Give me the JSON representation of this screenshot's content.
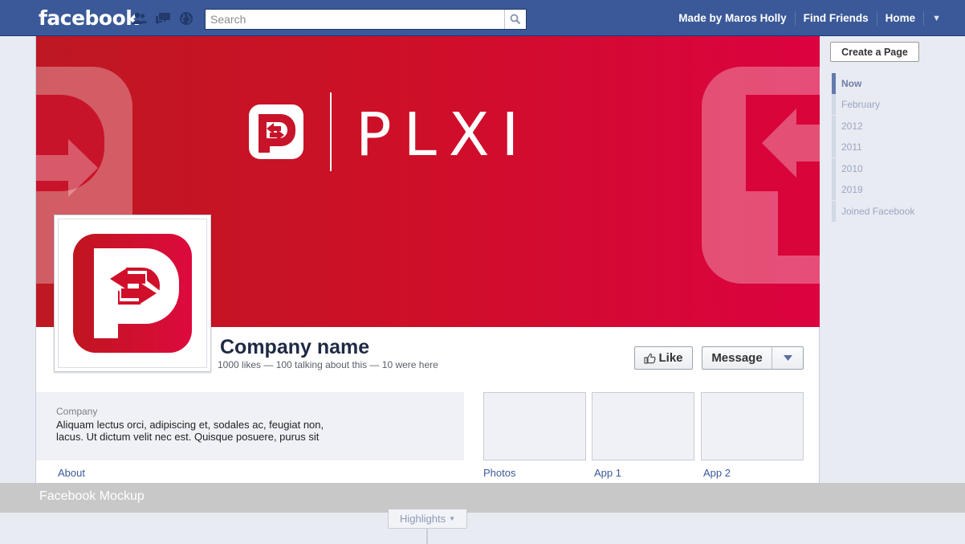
{
  "topbar": {
    "logo": "facebook",
    "search_placeholder": "Search",
    "nav_links": [
      "Made by Maros Holly",
      "Find Friends",
      "Home"
    ]
  },
  "cover": {
    "brand_word": "PLXI",
    "colors": {
      "start": "#be1822",
      "end": "#dc0240"
    }
  },
  "page": {
    "name": "Company name",
    "stats": "1000 likes — 100 talking about this — 10 were here"
  },
  "actions": {
    "like_label": "Like",
    "message_label": "Message"
  },
  "about": {
    "title": "Company",
    "text": "Aliquam lectus orci, adipiscing et, sodales ac, feugiat non, lacus. Ut dictum velit nec est. Quisque posuere, purus sit",
    "link": "About"
  },
  "tiles": [
    "Photos",
    "App 1",
    "App 2"
  ],
  "sidebar": {
    "create_page": "Create a Page",
    "timeline": [
      "Now",
      "February",
      "2012",
      "2011",
      "2010",
      "2019",
      "Joined Facebook"
    ]
  },
  "banner": {
    "text": "Facebook Mockup"
  },
  "highlights": {
    "label": "Highlights"
  }
}
